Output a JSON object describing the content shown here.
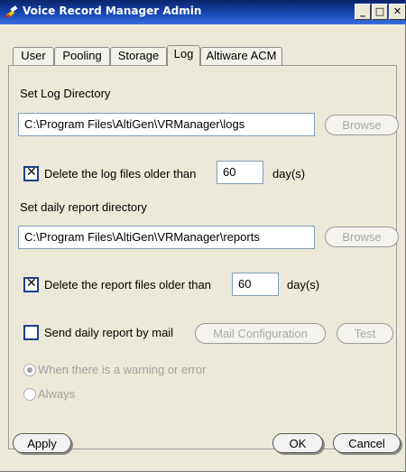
{
  "window": {
    "title": "Voice Record Manager Admin",
    "minimize": "_",
    "maximize": "□",
    "close": "✕",
    "icons": [
      "app-icon",
      "minimize-icon",
      "maximize-icon",
      "close-icon"
    ]
  },
  "tabs": [
    {
      "label": "User",
      "active": false
    },
    {
      "label": "Pooling",
      "active": false
    },
    {
      "label": "Storage",
      "active": false
    },
    {
      "label": "Log",
      "active": true
    },
    {
      "label": "Altiware ACM",
      "active": false
    }
  ],
  "log": {
    "log_dir_label": "Set Log Directory",
    "log_dir_value": "C:\\Program Files\\AltiGen\\VRManager\\logs",
    "browse_label": "Browse",
    "delete_logs_checked": true,
    "delete_logs_label": "Delete the log files older than",
    "delete_logs_days": "60",
    "days_unit": "day(s)"
  },
  "report": {
    "report_dir_label": "Set daily report directory",
    "report_dir_value": "C:\\Program Files\\AltiGen\\VRManager\\reports",
    "browse_label": "Browse",
    "delete_reports_checked": true,
    "delete_reports_label": "Delete the report files older than",
    "delete_reports_days": "60",
    "days_unit": "day(s)"
  },
  "mail": {
    "send_checked": false,
    "send_label": "Send daily report by mail",
    "mail_config_label": "Mail Configuration",
    "test_label": "Test",
    "options": [
      {
        "label": "When there is a warning or error",
        "selected": true
      },
      {
        "label": "Always",
        "selected": false
      }
    ]
  },
  "footer": {
    "apply_label": "Apply",
    "ok_label": "OK",
    "cancel_label": "Cancel"
  },
  "colors": {
    "titlebar": "#0a246a",
    "window_bg": "#ece9d8",
    "disabled_text": "#a9a9a9"
  }
}
